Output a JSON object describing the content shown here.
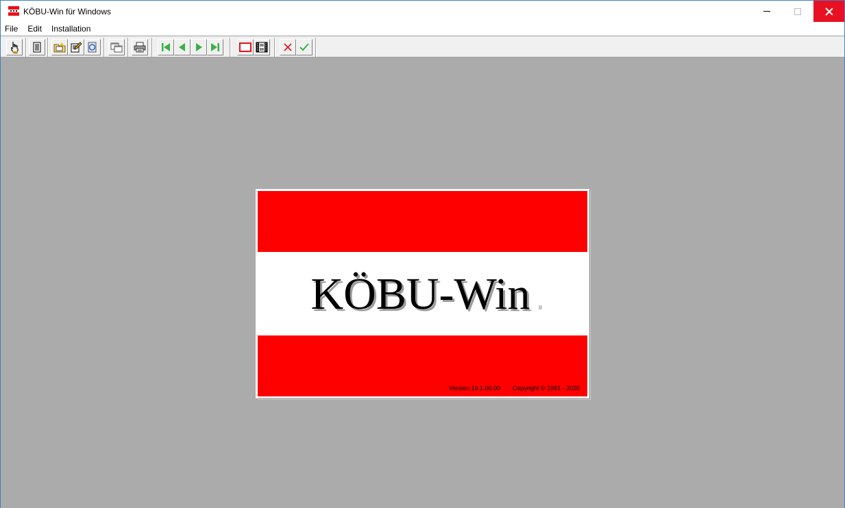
{
  "window": {
    "title": "KÖBU-Win für Windows",
    "controls": {
      "minimize": "minimize",
      "maximize": "maximize",
      "close": "close"
    }
  },
  "menu": {
    "items": [
      {
        "label": "File"
      },
      {
        "label": "Edit"
      },
      {
        "label": "Installation"
      }
    ]
  },
  "toolbar": {
    "buttons": [
      {
        "icon": "hand-pointer-icon"
      },
      {
        "icon": "document-list-icon"
      },
      {
        "icon": "folder-star-icon"
      },
      {
        "icon": "edit-document-icon"
      },
      {
        "icon": "recycle-document-icon"
      },
      {
        "icon": "copy-windows-icon"
      },
      {
        "icon": "printer-icon"
      },
      {
        "icon": "first-record-icon"
      },
      {
        "icon": "previous-record-icon"
      },
      {
        "icon": "next-record-icon"
      },
      {
        "icon": "last-record-icon"
      },
      {
        "icon": "window-frame-icon"
      },
      {
        "icon": "film-strip-icon"
      },
      {
        "icon": "cancel-x-icon"
      },
      {
        "icon": "confirm-check-icon"
      }
    ]
  },
  "splash": {
    "logo_text": "KÖBU-Win",
    "trademark": "II",
    "version": "Version 19.1.00.00",
    "copyright": "Copyright © 1991 - 2020"
  },
  "colors": {
    "flag_red": "#ff0000",
    "workspace_gray": "#ababab",
    "close_button_red": "#e81123",
    "nav_green": "#3cb043",
    "cancel_red": "#e8101a"
  }
}
